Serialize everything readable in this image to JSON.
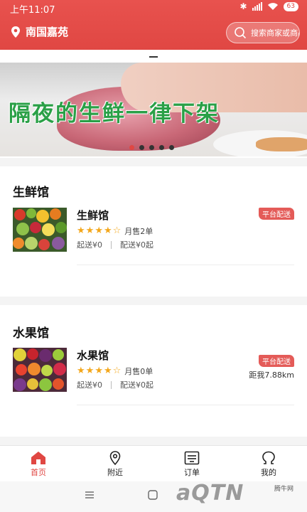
{
  "status": {
    "time": "上午11:07",
    "battery": "63",
    "signal": "4G"
  },
  "header": {
    "location": "南国嘉苑",
    "search_placeholder": "搜索商家或商品"
  },
  "banner": {
    "text": "隔夜的生鲜一律下架",
    "dot_count": 5,
    "active_dot": 0
  },
  "sections": [
    {
      "title": "生鲜馆",
      "shop": {
        "name": "生鲜馆",
        "rating": 4,
        "max_rating": 5,
        "sales": "月售2单",
        "min_order": "起送¥0",
        "delivery": "配送¥0起",
        "badge": "平台配送",
        "distance": ""
      }
    },
    {
      "title": "水果馆",
      "shop": {
        "name": "水果馆",
        "rating": 4,
        "max_rating": 5,
        "sales": "月售0单",
        "min_order": "起送¥0",
        "delivery": "配送¥0起",
        "badge": "平台配送",
        "distance": "距我7.88km"
      }
    }
  ],
  "tabbar": {
    "items": [
      {
        "label": "首页",
        "icon": "home-icon",
        "active": true
      },
      {
        "label": "附近",
        "icon": "location-pin-icon",
        "active": false
      },
      {
        "label": "订单",
        "icon": "order-icon",
        "active": false
      },
      {
        "label": "我的",
        "icon": "profile-icon",
        "active": false
      }
    ]
  },
  "watermark": {
    "logo": "aQTN",
    "small": "腾牛网"
  },
  "colors": {
    "brand": "#e04743",
    "star": "#f3a71b",
    "badge": "#e45b58",
    "banner_text": "#2aa047"
  }
}
